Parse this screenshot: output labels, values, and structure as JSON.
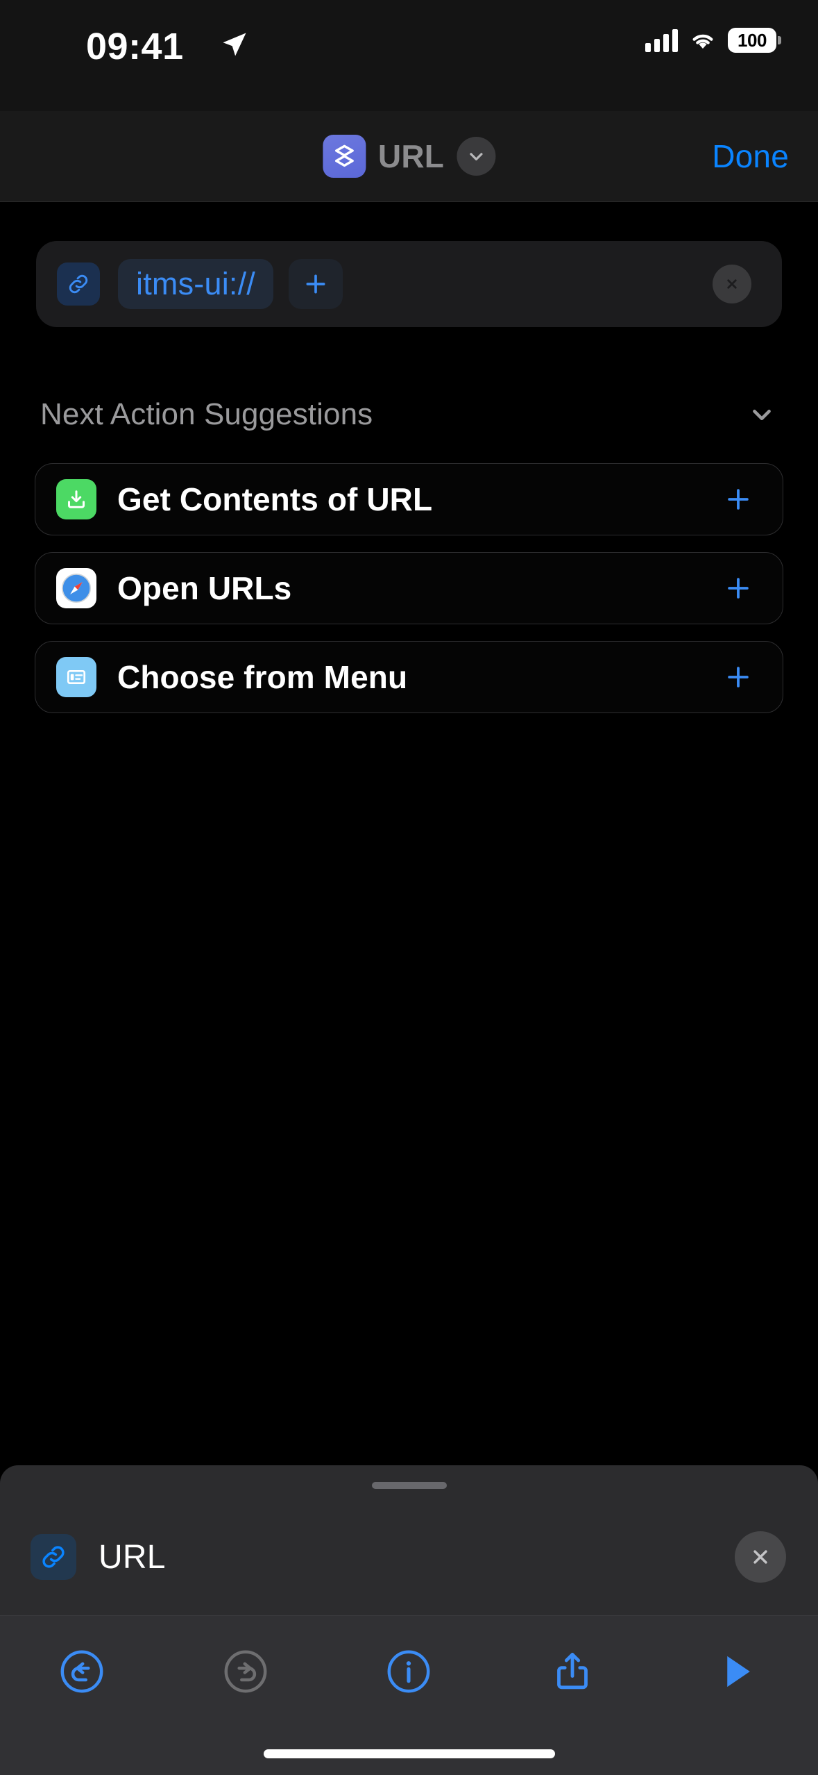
{
  "status_bar": {
    "time": "09:41",
    "battery_percent": "100",
    "location_icon": "location-arrow-icon",
    "signal_icon": "cellular-signal-icon",
    "wifi_icon": "wifi-icon"
  },
  "nav_bar": {
    "app_icon": "shortcuts-app-icon",
    "title": "URL",
    "chevron_icon": "chevron-down-icon",
    "done_label": "Done"
  },
  "url_action": {
    "link_icon": "link-icon",
    "value": "itms-ui://",
    "add_icon": "plus-icon",
    "clear_icon": "close-x-icon"
  },
  "suggestions": {
    "header": "Next Action Suggestions",
    "collapse_icon": "chevron-down-icon",
    "items": [
      {
        "label": "Get Contents of URL",
        "icon": "download-tray-icon",
        "icon_color": "#4CD964",
        "add_icon": "plus-icon"
      },
      {
        "label": "Open URLs",
        "icon": "safari-compass-icon",
        "icon_color": "#FFFFFF",
        "add_icon": "plus-icon"
      },
      {
        "label": "Choose from Menu",
        "icon": "menu-list-icon",
        "icon_color": "#7FC9F5",
        "add_icon": "plus-icon"
      }
    ]
  },
  "sheet": {
    "grabber": "sheet-grabber",
    "icon": "link-icon",
    "title": "URL",
    "close_icon": "close-x-icon"
  },
  "toolbar": {
    "buttons": [
      {
        "name": "undo-button",
        "icon": "undo-arrow-icon",
        "enabled": true
      },
      {
        "name": "redo-button",
        "icon": "redo-arrow-icon",
        "enabled": false
      },
      {
        "name": "info-button",
        "icon": "info-circle-icon",
        "enabled": true
      },
      {
        "name": "share-button",
        "icon": "share-upload-icon",
        "enabled": true
      },
      {
        "name": "run-button",
        "icon": "play-triangle-icon",
        "enabled": true
      }
    ]
  },
  "colors": {
    "accent_blue": "#0A84FF",
    "link_blue": "#3B8CF5",
    "shortcut_purple": "#5B68D8",
    "green": "#4CD964",
    "light_blue": "#7FC9F5",
    "background": "#000000",
    "sheet_background": "#2C2C2E",
    "toolbar_background": "#313134",
    "secondary_text": "#9A9A9C"
  }
}
